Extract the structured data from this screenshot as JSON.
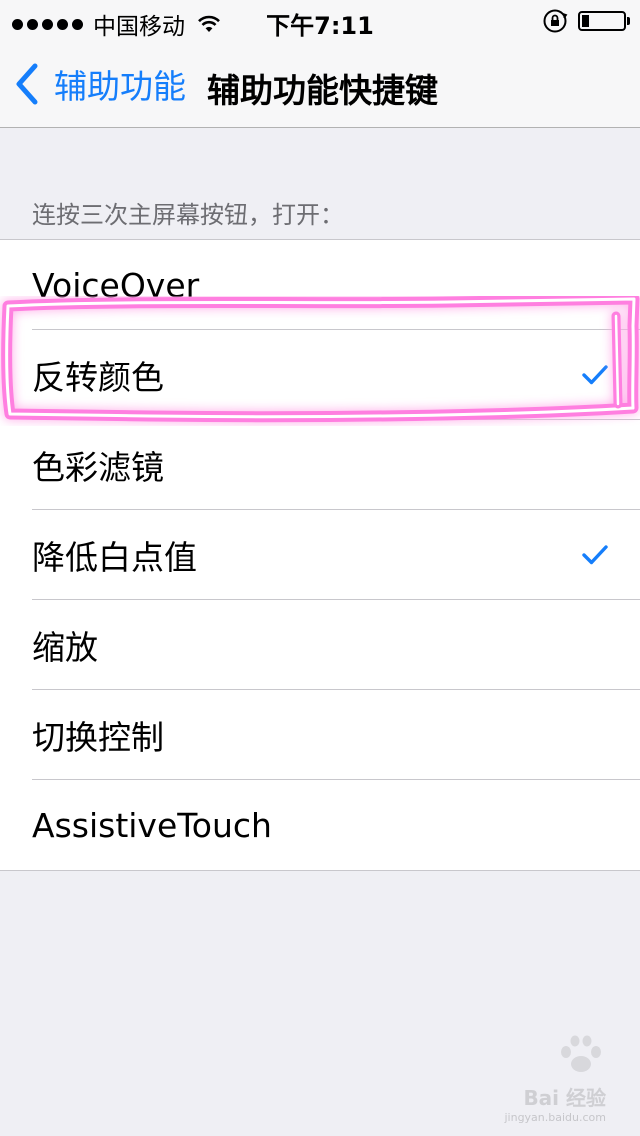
{
  "status_bar": {
    "carrier": "中国移动",
    "time": "下午7:11",
    "battery_level": 0.18
  },
  "nav": {
    "back_label": "辅助功能",
    "title": "辅助功能快捷键"
  },
  "section": {
    "header": "连按三次主屏幕按钮，打开："
  },
  "items": [
    {
      "label": "VoiceOver",
      "checked": false
    },
    {
      "label": "反转颜色",
      "checked": true
    },
    {
      "label": "色彩滤镜",
      "checked": false
    },
    {
      "label": "降低白点值",
      "checked": true
    },
    {
      "label": "缩放",
      "checked": false
    },
    {
      "label": "切换控制",
      "checked": false
    },
    {
      "label": "AssistiveTouch",
      "checked": false
    }
  ],
  "colors": {
    "accent": "#157efb",
    "highlight": "#ff3cc8"
  },
  "watermark": {
    "logo_text": "Bai 经验",
    "url_text": "jingyan.baidu.com"
  }
}
